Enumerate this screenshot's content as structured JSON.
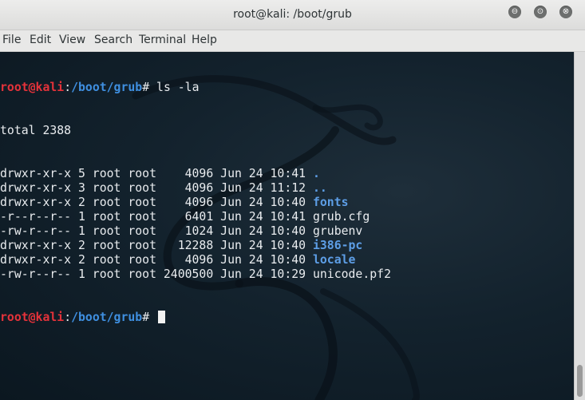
{
  "window": {
    "title": "root@kali: /boot/grub"
  },
  "controls": {
    "minimize": "⊖",
    "maximize": "⊙",
    "close": "⊗"
  },
  "menu": [
    "File",
    "Edit",
    "View",
    "Search",
    "Terminal",
    "Help"
  ],
  "prompt": {
    "user_host": "root@kali",
    "separator": ":",
    "path": "/boot/grub",
    "symbol": "# "
  },
  "command": "ls -la",
  "total_line": "total 2388",
  "listing": [
    {
      "meta": "drwxr-xr-x 5 root root    4096 Jun 24 10:41 ",
      "name": ".",
      "is_dir": true
    },
    {
      "meta": "drwxr-xr-x 3 root root    4096 Jun 24 11:12 ",
      "name": "..",
      "is_dir": true
    },
    {
      "meta": "drwxr-xr-x 2 root root    4096 Jun 24 10:40 ",
      "name": "fonts",
      "is_dir": true
    },
    {
      "meta": "-r--r--r-- 1 root root    6401 Jun 24 10:41 ",
      "name": "grub.cfg",
      "is_dir": false
    },
    {
      "meta": "-rw-r--r-- 1 root root    1024 Jun 24 10:40 ",
      "name": "grubenv",
      "is_dir": false
    },
    {
      "meta": "drwxr-xr-x 2 root root   12288 Jun 24 10:40 ",
      "name": "i386-pc",
      "is_dir": true
    },
    {
      "meta": "drwxr-xr-x 2 root root    4096 Jun 24 10:40 ",
      "name": "locale",
      "is_dir": true
    },
    {
      "meta": "-rw-r--r-- 1 root root 2400500 Jun 24 10:29 ",
      "name": "unicode.pf2",
      "is_dir": false
    }
  ],
  "colors": {
    "prompt_user": "#e4323a",
    "prompt_path": "#3f8fe0",
    "directory": "#5d9ee6",
    "text": "#e9ecef",
    "background": "#13222d"
  }
}
